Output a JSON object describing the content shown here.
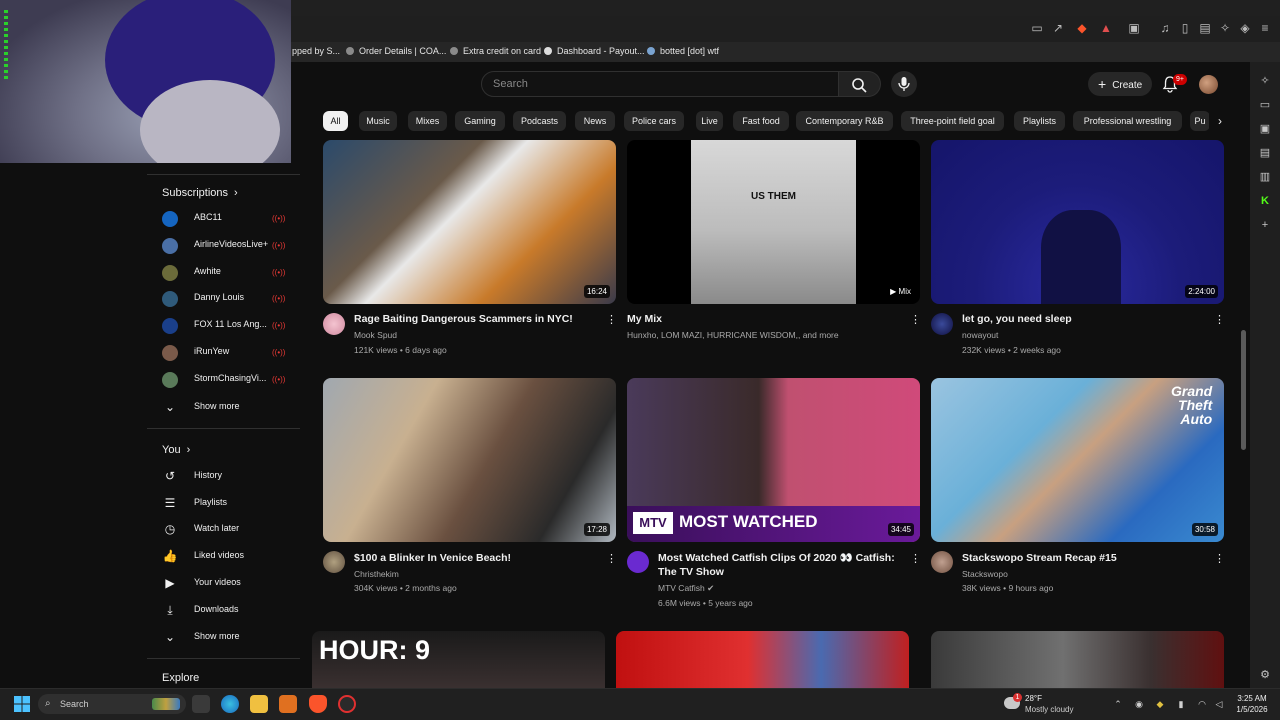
{
  "bookmarks": [
    {
      "label": "pped by S..."
    },
    {
      "label": "Order Details | COA..."
    },
    {
      "label": "Extra credit on card"
    },
    {
      "label": "Dashboard - Payout..."
    },
    {
      "label": "botted [dot] wtf"
    }
  ],
  "header": {
    "search_placeholder": "Search",
    "create_label": "Create",
    "notifications_count": "9+"
  },
  "chips": [
    "All",
    "Music",
    "Mixes",
    "Gaming",
    "Podcasts",
    "News",
    "Police cars",
    "Live",
    "Fast food",
    "Contemporary R&B",
    "Three-point field goal",
    "Playlists",
    "Professional wrestling",
    "Pu"
  ],
  "sidebar": {
    "subscriptions_title": "Subscriptions",
    "subscriptions": [
      {
        "name": "ABC11",
        "color": "#1565c0"
      },
      {
        "name": "AirlineVideosLive+",
        "color": "#4a6fa5"
      },
      {
        "name": "Awhite",
        "color": "#6b6b3a"
      },
      {
        "name": "Danny Louis",
        "color": "#2f5a7a"
      },
      {
        "name": "FOX 11 Los Ang...",
        "color": "#1a3f8a"
      },
      {
        "name": "iRunYew",
        "color": "#7a5a4a"
      },
      {
        "name": "StormChasingVi...",
        "color": "#5a7a5a"
      }
    ],
    "show_more_1": "Show more",
    "you_title": "You",
    "you_items": [
      {
        "label": "History",
        "icon": "history-icon"
      },
      {
        "label": "Playlists",
        "icon": "playlists-icon"
      },
      {
        "label": "Watch later",
        "icon": "clock-icon"
      },
      {
        "label": "Liked videos",
        "icon": "thumbs-up-icon"
      },
      {
        "label": "Your videos",
        "icon": "play-square-icon"
      },
      {
        "label": "Downloads",
        "icon": "download-icon"
      }
    ],
    "show_more_2": "Show more",
    "explore_title": "Explore"
  },
  "videos": [
    {
      "title": "Rage Baiting Dangerous Scammers in NYC!",
      "channel": "Mook Spud",
      "meta": "121K views • 6 days ago",
      "duration": "16:24"
    },
    {
      "title": "My Mix",
      "channel": "Hunxho, LOM MAZI, HURRICANE WISDOM,, and more",
      "meta": "",
      "duration": "Mix"
    },
    {
      "title": "let go, you need sleep",
      "channel": "nowayout",
      "meta": "232K views • 2 weeks ago",
      "duration": "2:24:00"
    },
    {
      "title": "$100 a Blinker In Venice Beach!",
      "channel": "Christhekim",
      "meta": "304K views • 2 months ago",
      "duration": "17:28"
    },
    {
      "title": "Most Watched Catfish Clips Of 2020 👀 Catfish: The TV Show",
      "channel": "MTV Catfish",
      "meta": "6.6M views • 5 years ago",
      "duration": "34:45"
    },
    {
      "title": "Stackswopo Stream Recap #15",
      "channel": "Stackswopo",
      "meta": "38K views • 9 hours ago",
      "duration": "30:58"
    }
  ],
  "thumb_text": {
    "us_them": "US THEM",
    "most_watched": "MOST WATCHED",
    "hour": "HOUR: 9"
  },
  "taskbar": {
    "search_label": "Search",
    "weather_temp": "28°F",
    "weather_desc": "Mostly cloudy",
    "weather_badge": "1",
    "time": "3:25 AM",
    "date": "1/5/2026"
  }
}
